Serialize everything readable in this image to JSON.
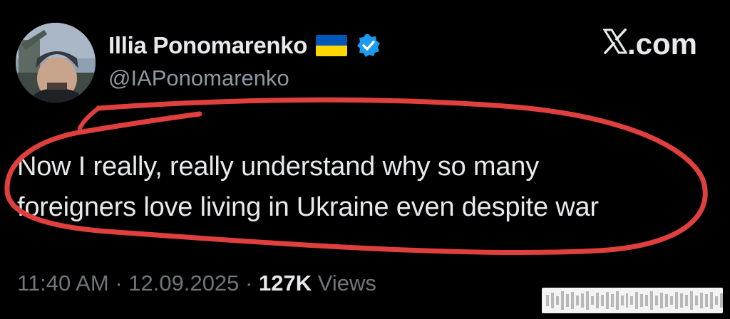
{
  "author": {
    "display_name": "Illia Ponomarenko",
    "handle": "@IAPonomarenko",
    "flag_icon": "ukraine-flag-icon",
    "verified_icon": "verified-badge-icon",
    "verified_color": "#1d9bf0"
  },
  "site": {
    "label": ".com",
    "logo_icon": "x-logo-icon"
  },
  "tweet": {
    "lines": [
      "Now I really, really understand why so many",
      "foreigners love living in Ukraine even despite war"
    ]
  },
  "meta": {
    "time": "11:40 AM",
    "separator": "·",
    "date": "12.09.2025",
    "views_count": "127K",
    "views_label": "Views"
  },
  "colors": {
    "background": "#000000",
    "text": "#e7e9ea",
    "muted": "#71767b",
    "annotation": "#e0403d",
    "flag_blue": "#0057b7",
    "flag_yellow": "#ffd700"
  }
}
